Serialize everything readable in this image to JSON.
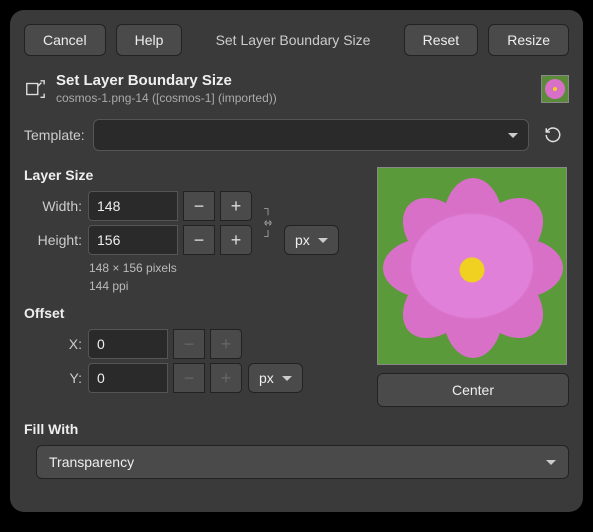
{
  "buttons": {
    "cancel": "Cancel",
    "help": "Help",
    "reset": "Reset",
    "resize": "Resize",
    "center": "Center"
  },
  "title_bar": "Set Layer Boundary Size",
  "header": {
    "title": "Set Layer Boundary Size",
    "subtitle": "cosmos-1.png-14 ([cosmos-1] (imported))"
  },
  "template": {
    "label": "Template:",
    "value": ""
  },
  "layer_size": {
    "title": "Layer Size",
    "width_label": "Width:",
    "height_label": "Height:",
    "width": "148",
    "height": "156",
    "unit": "px",
    "info1": "148 × 156 pixels",
    "info2": "144 ppi"
  },
  "offset": {
    "title": "Offset",
    "x_label": "X:",
    "y_label": "Y:",
    "x": "0",
    "y": "0",
    "unit": "px"
  },
  "fill": {
    "title": "Fill With",
    "value": "Transparency"
  }
}
